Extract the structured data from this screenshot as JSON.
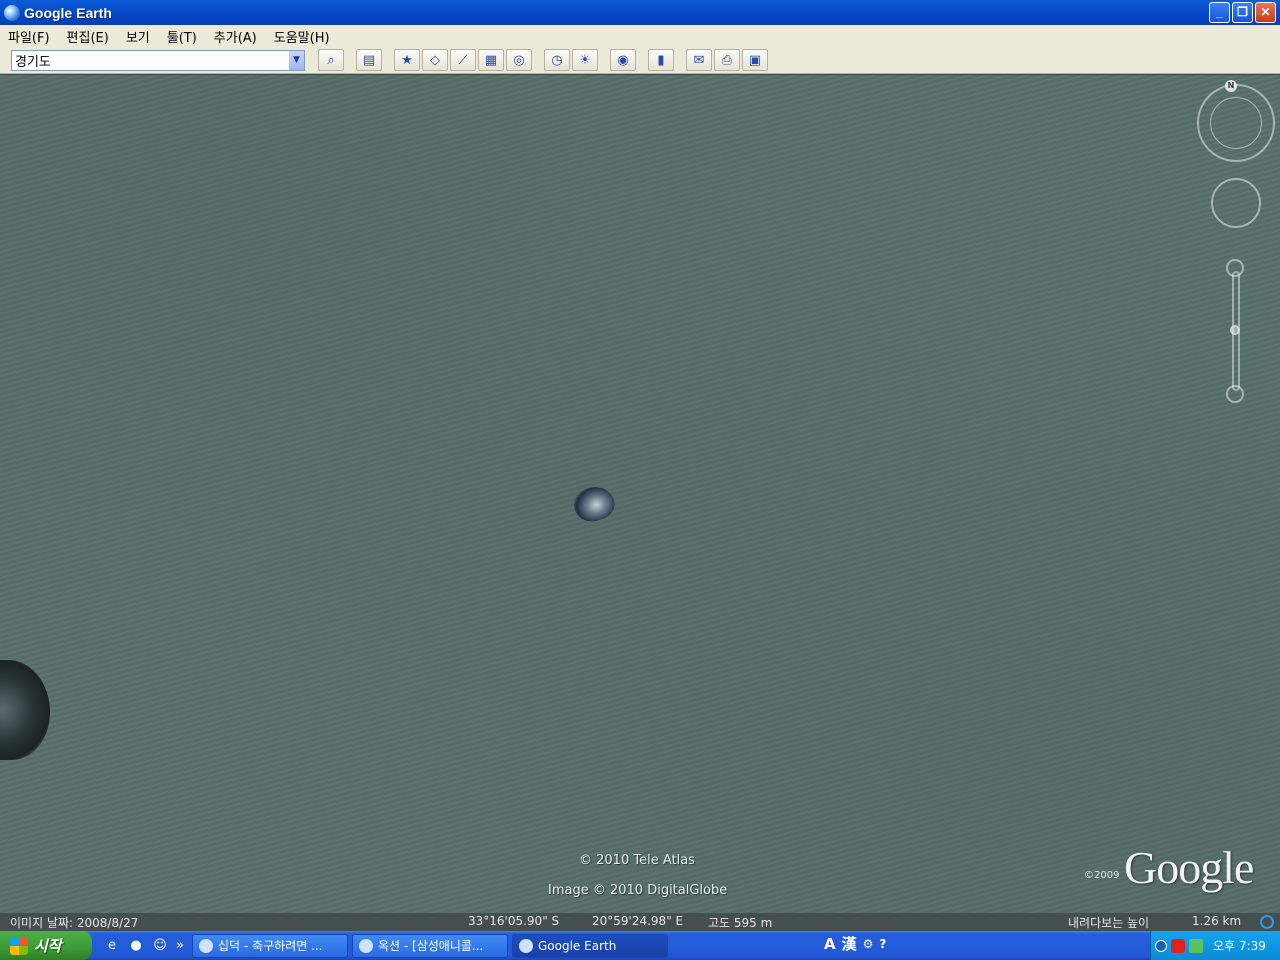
{
  "window": {
    "title": "Google Earth"
  },
  "menubar": {
    "items": [
      "파일(F)",
      "편집(E)",
      "보기",
      "툴(T)",
      "추가(A)",
      "도움말(H)"
    ]
  },
  "toolbar": {
    "search_value": "경기도",
    "buttons": [
      {
        "name": "sidebar-toggle-icon",
        "glyph": "▤"
      },
      {
        "name": "placemark-icon",
        "glyph": "★"
      },
      {
        "name": "polygon-icon",
        "glyph": "◇"
      },
      {
        "name": "path-icon",
        "glyph": "⟋"
      },
      {
        "name": "image-overlay-icon",
        "glyph": "▦"
      },
      {
        "name": "record-tour-icon",
        "glyph": "◎"
      },
      {
        "name": "historical-imagery-icon",
        "glyph": "◷"
      },
      {
        "name": "sunlight-icon",
        "glyph": "☀"
      },
      {
        "name": "planets-icon",
        "glyph": "◉"
      },
      {
        "name": "ruler-icon",
        "glyph": "▮"
      },
      {
        "name": "email-icon",
        "glyph": "✉"
      },
      {
        "name": "print-icon",
        "glyph": "⎙"
      },
      {
        "name": "view-in-maps-icon",
        "glyph": "▣"
      }
    ]
  },
  "map": {
    "credit_tele_atlas": "© 2010 Tele Atlas",
    "credit_digitalglobe": "Image © 2010 DigitalGlobe",
    "logo_year": "©2009",
    "logo_text": "Google",
    "compass_n": "N"
  },
  "statusbar": {
    "image_date": "이미지 날짜: 2008/8/27",
    "latitude": "33°16'05.90\" S",
    "longitude": "20°59'24.98\" E",
    "altitude": "고도  595 m",
    "eye_alt_label": "내려다보는 높이",
    "eye_alt_value": "1.26 km"
  },
  "taskbar": {
    "start_label": "시작",
    "chevron": "»",
    "tasks": [
      {
        "label": "십덕 - 축구하려면 ...",
        "active": false
      },
      {
        "label": "옥션 - [삼성애니콜...",
        "active": false
      },
      {
        "label": "Google Earth",
        "active": true
      }
    ],
    "ime": [
      "A",
      "漢"
    ],
    "clock": "오후 7:39"
  }
}
